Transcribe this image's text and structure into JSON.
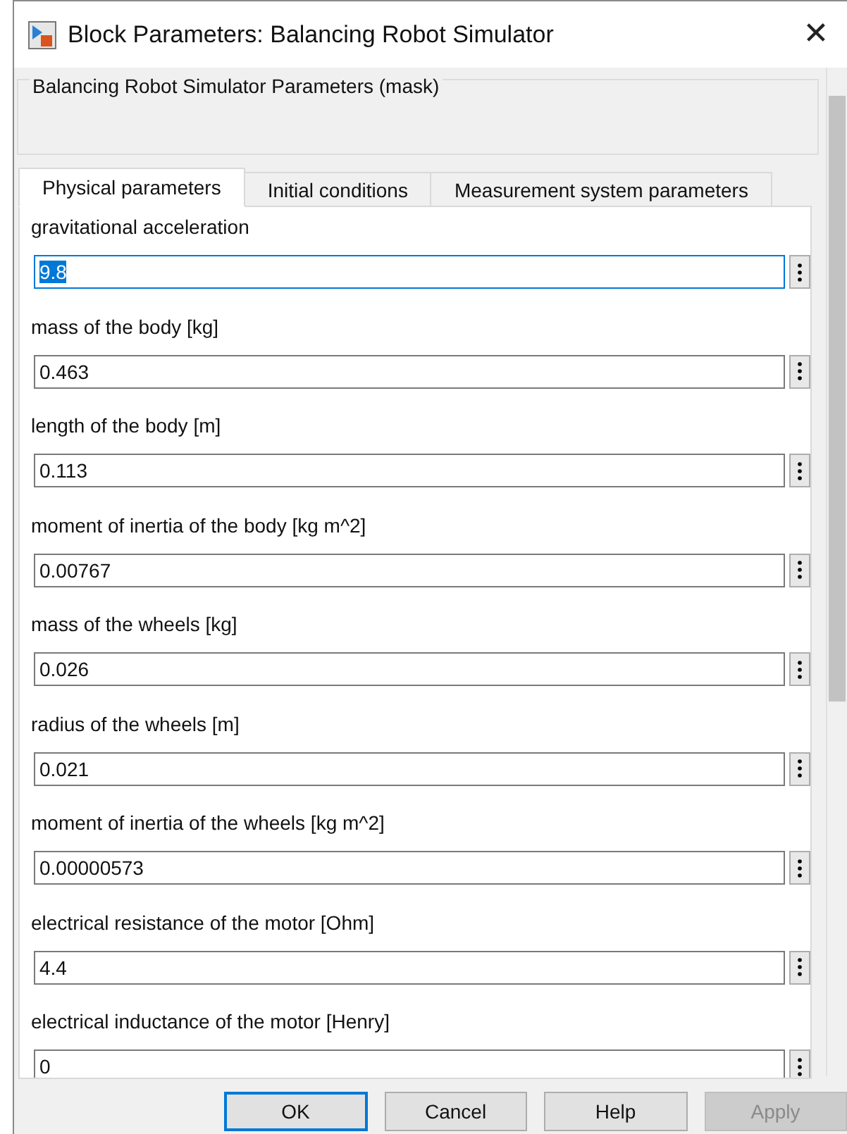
{
  "window": {
    "title": "Block Parameters: Balancing Robot Simulator",
    "close": "✕"
  },
  "mask_group": {
    "title": "Balancing Robot Simulator Parameters (mask)"
  },
  "tabs": [
    {
      "label": "Physical parameters",
      "selected": true
    },
    {
      "label": "Initial conditions",
      "selected": false
    },
    {
      "label": "Measurement system parameters",
      "selected": false
    }
  ],
  "parameters": [
    {
      "label": "gravitational acceleration",
      "value": "9.8",
      "selected": true
    },
    {
      "label": "mass of the body [kg]",
      "value": "0.463",
      "selected": false
    },
    {
      "label": "length of the body [m]",
      "value": "0.113",
      "selected": false
    },
    {
      "label": "moment of inertia of the body [kg m^2]",
      "value": "0.00767",
      "selected": false
    },
    {
      "label": "mass of the wheels [kg]",
      "value": "0.026",
      "selected": false
    },
    {
      "label": "radius of the wheels [m]",
      "value": "0.021",
      "selected": false
    },
    {
      "label": "moment of inertia of the wheels [kg m^2]",
      "value": "0.00000573",
      "selected": false
    },
    {
      "label": "electrical resistance of the motor [Ohm]",
      "value": "4.4",
      "selected": false
    },
    {
      "label": "electrical inductance of the motor [Henry]",
      "value": "0",
      "selected": false
    }
  ],
  "buttons": [
    {
      "label": "OK",
      "disabled": false,
      "default": true
    },
    {
      "label": "Cancel",
      "disabled": false,
      "default": false
    },
    {
      "label": "Help",
      "disabled": false,
      "default": false
    },
    {
      "label": "Apply",
      "disabled": true,
      "default": false
    }
  ]
}
